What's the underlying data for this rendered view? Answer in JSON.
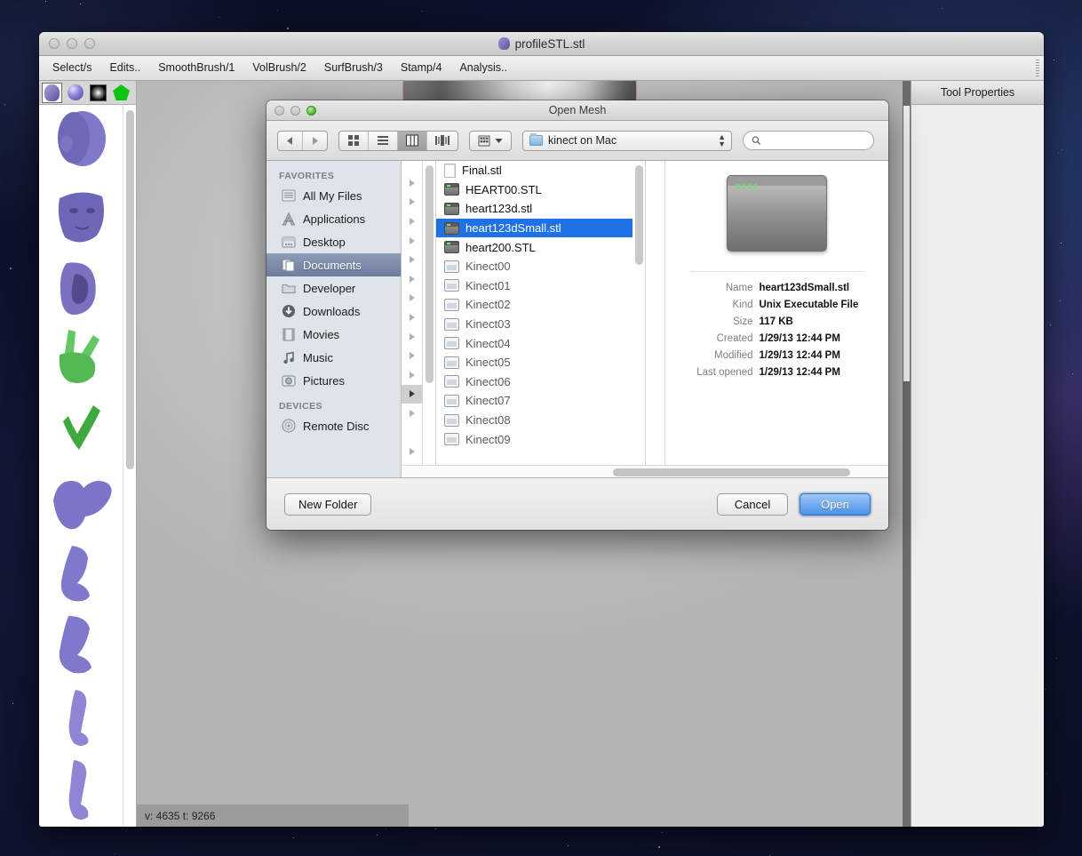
{
  "desktop": {
    "name": "space-wallpaper"
  },
  "app_window": {
    "title": "profileSTL.stl",
    "title_icon": "head-icon",
    "traffic_lights": [
      "close-button",
      "minimize-button",
      "zoom-button"
    ],
    "menubar": [
      {
        "label": "Select/s"
      },
      {
        "label": "Edits.."
      },
      {
        "label": "SmoothBrush/1"
      },
      {
        "label": "VolBrush/2"
      },
      {
        "label": "SurfBrush/3"
      },
      {
        "label": "Stamp/4"
      },
      {
        "label": "Analysis.."
      }
    ],
    "palette": {
      "tabs": [
        {
          "name": "mesh-tab",
          "icon": "head-icon",
          "selected": true
        },
        {
          "name": "sphere-tab",
          "icon": "sphere-icon",
          "selected": false
        },
        {
          "name": "alpha-tab",
          "icon": "alpha-icon",
          "selected": false
        },
        {
          "name": "polygon-tab",
          "icon": "pentagon-icon",
          "selected": false
        }
      ],
      "items": [
        {
          "name": "head-mesh",
          "color": "#7b73c4"
        },
        {
          "name": "face-mesh",
          "color": "#6f67b9"
        },
        {
          "name": "ear-mesh",
          "color": "#7a72c0"
        },
        {
          "name": "hand-peace-mesh",
          "color": "#63c863"
        },
        {
          "name": "hand-check-mesh",
          "color": "#3fa83f"
        },
        {
          "name": "torso-mesh",
          "color": "#7c74c6"
        },
        {
          "name": "leg-mesh-1",
          "color": "#8078cb"
        },
        {
          "name": "leg-mesh-2",
          "color": "#8078cb"
        },
        {
          "name": "arm-mesh-1",
          "color": "#8e86d4"
        },
        {
          "name": "arm-mesh-2",
          "color": "#8e86d4"
        }
      ]
    },
    "viewport": {
      "status": "v: 4635 t: 9266"
    },
    "tool_properties": {
      "title": "Tool Properties"
    }
  },
  "open_dialog": {
    "title": "Open Mesh",
    "traffic_lights": [
      "close-button",
      "minimize-button",
      "zoom-button"
    ],
    "toolbar": {
      "nav": {
        "back": "◀",
        "forward": "▶"
      },
      "view_modes": [
        {
          "name": "icon-view",
          "selected": false
        },
        {
          "name": "list-view",
          "selected": false
        },
        {
          "name": "column-view",
          "selected": true
        },
        {
          "name": "coverflow-view",
          "selected": false
        }
      ],
      "action_menu": "action-gear-menu",
      "path_popup": {
        "label": "kinect on Mac",
        "icon": "folder-icon"
      },
      "search": {
        "placeholder": "",
        "value": "",
        "icon": "search-icon"
      }
    },
    "sidebar": {
      "sections": [
        {
          "header": "FAVORITES",
          "items": [
            {
              "label": "All My Files",
              "icon": "all-my-files-icon",
              "selected": false
            },
            {
              "label": "Applications",
              "icon": "applications-icon",
              "selected": false
            },
            {
              "label": "Desktop",
              "icon": "desktop-icon",
              "selected": false
            },
            {
              "label": "Documents",
              "icon": "documents-icon",
              "selected": true
            },
            {
              "label": "Developer",
              "icon": "folder-icon",
              "selected": false
            },
            {
              "label": "Downloads",
              "icon": "downloads-icon",
              "selected": false
            },
            {
              "label": "Movies",
              "icon": "movies-icon",
              "selected": false
            },
            {
              "label": "Music",
              "icon": "music-icon",
              "selected": false
            },
            {
              "label": "Pictures",
              "icon": "pictures-icon",
              "selected": false
            }
          ]
        },
        {
          "header": "DEVICES",
          "items": [
            {
              "label": "Remote Disc",
              "icon": "remote-disc-icon",
              "selected": false
            }
          ]
        }
      ]
    },
    "file_list": [
      {
        "label": "Final.stl",
        "icon": "document-icon",
        "selected": false,
        "dim": false,
        "expandable": false
      },
      {
        "label": "HEART00.STL",
        "icon": "executable-icon",
        "selected": false,
        "dim": false,
        "expandable": true
      },
      {
        "label": "heart123d.stl",
        "icon": "executable-icon",
        "selected": false,
        "dim": false,
        "expandable": true
      },
      {
        "label": "heart123dSmall.stl",
        "icon": "executable-icon",
        "selected": true,
        "dim": false,
        "expandable": true
      },
      {
        "label": "heart200.STL",
        "icon": "executable-icon",
        "selected": false,
        "dim": false,
        "expandable": true
      },
      {
        "label": "Kinect00",
        "icon": "window-icon",
        "selected": false,
        "dim": true,
        "expandable": true
      },
      {
        "label": "Kinect01",
        "icon": "window-icon",
        "selected": false,
        "dim": true,
        "expandable": true
      },
      {
        "label": "Kinect02",
        "icon": "window-icon",
        "selected": false,
        "dim": true,
        "expandable": true
      },
      {
        "label": "Kinect03",
        "icon": "window-icon",
        "selected": false,
        "dim": true,
        "expandable": true
      },
      {
        "label": "Kinect04",
        "icon": "window-icon",
        "selected": false,
        "dim": true,
        "expandable": true
      },
      {
        "label": "Kinect05",
        "icon": "window-icon",
        "selected": false,
        "dim": true,
        "expandable": true
      },
      {
        "label": "Kinect06",
        "icon": "window-icon",
        "selected": false,
        "dim": true,
        "expandable": true
      },
      {
        "label": "Kinect07",
        "icon": "window-icon",
        "selected": false,
        "dim": true,
        "expandable": true
      },
      {
        "label": "Kinect08",
        "icon": "window-icon",
        "selected": false,
        "dim": true,
        "expandable": true
      },
      {
        "label": "Kinect09",
        "icon": "window-icon",
        "selected": false,
        "dim": true,
        "expandable": true
      }
    ],
    "preview": {
      "icon_label": "exec",
      "icon_name": "unix-executable-icon",
      "metadata": [
        {
          "key": "Name",
          "value": "heart123dSmall.stl"
        },
        {
          "key": "Kind",
          "value": "Unix Executable File"
        },
        {
          "key": "Size",
          "value": "117 KB"
        },
        {
          "key": "Created",
          "value": "1/29/13 12:44 PM"
        },
        {
          "key": "Modified",
          "value": "1/29/13 12:44 PM"
        },
        {
          "key": "Last opened",
          "value": "1/29/13 12:44 PM"
        }
      ]
    },
    "footer": {
      "new_folder": "New Folder",
      "cancel": "Cancel",
      "open": "Open"
    }
  },
  "colors": {
    "selection_blue": "#1f72e5",
    "sidebar_selection": "#6d7d9e",
    "primary_button": "#4a92e8",
    "exec_green": "#6de06d"
  }
}
